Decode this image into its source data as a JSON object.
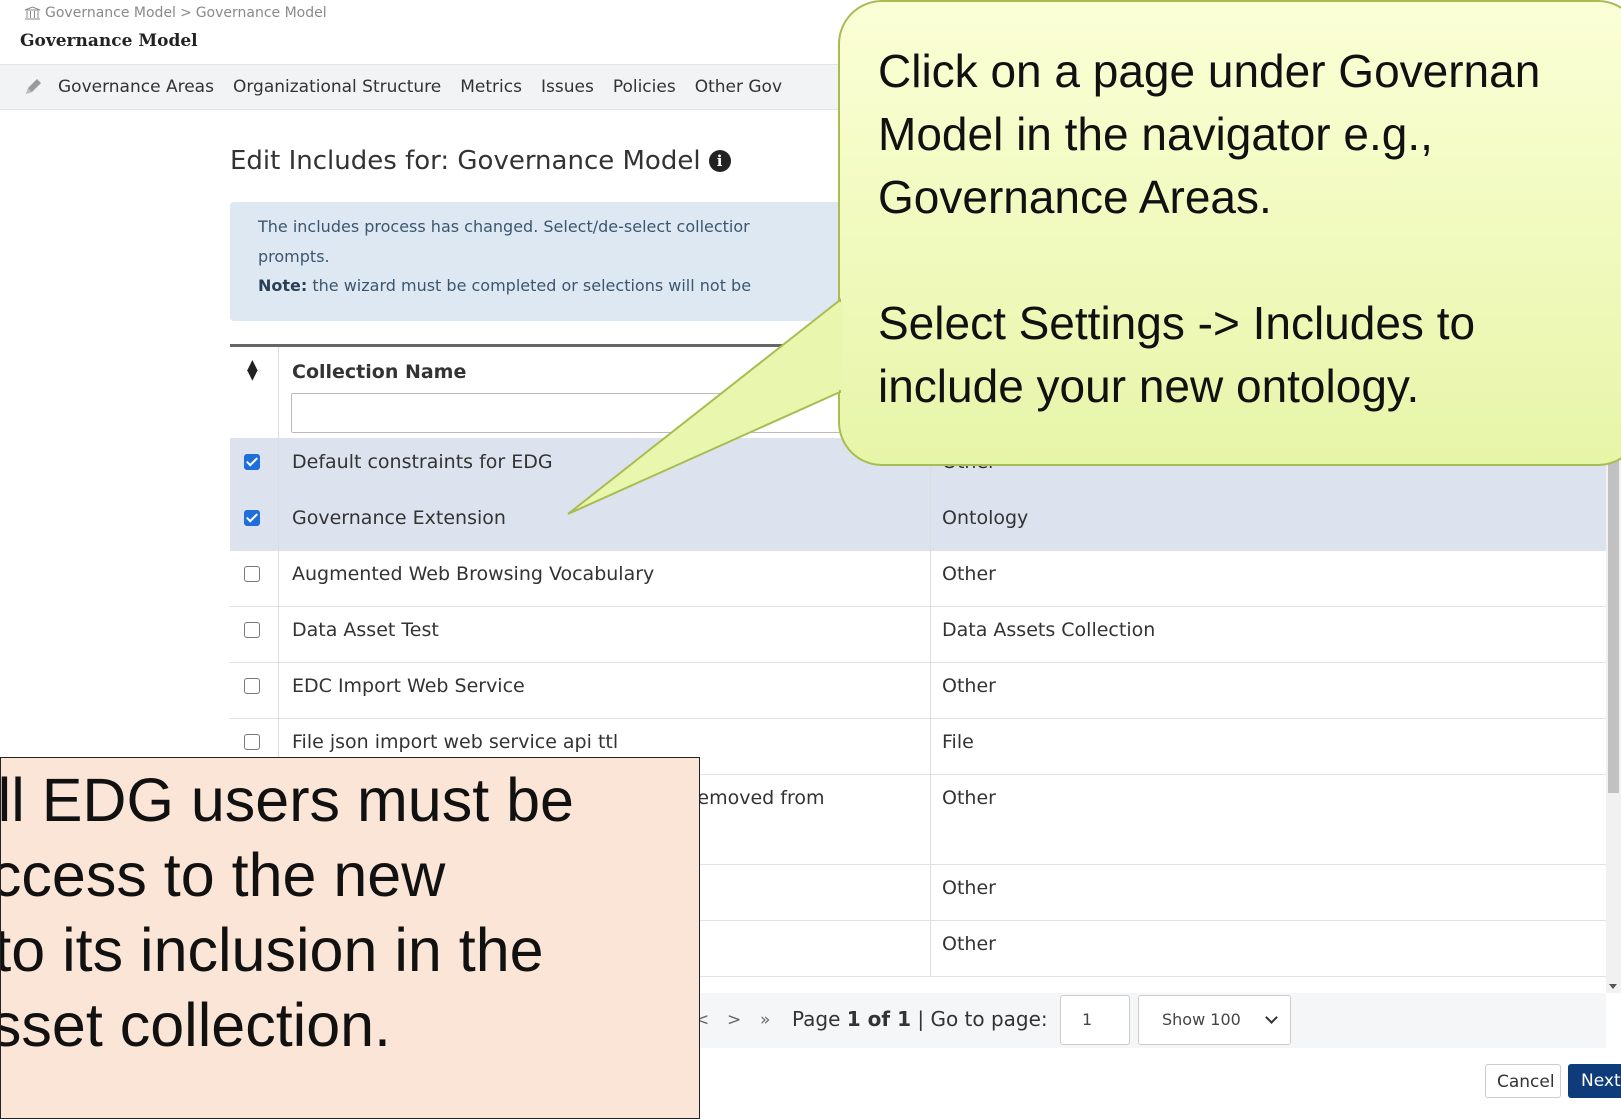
{
  "breadcrumb": {
    "root": "Governance Model",
    "separator": ">",
    "current": "Governance Model"
  },
  "page_title": "Governance Model",
  "nav": {
    "items": [
      "Governance Areas",
      "Organizational Structure",
      "Metrics",
      "Issues",
      "Policies",
      "Other Gov"
    ]
  },
  "edit": {
    "title": "Edit Includes for: Governance Model"
  },
  "infobox": {
    "line1": "The includes process has changed. Select/de-select collectior",
    "line2": "prompts.",
    "note_label": "Note:",
    "note_text": " the wizard must be completed or selections will not be"
  },
  "table": {
    "sort_icon": "sort-icon",
    "column_name": "Collection Name",
    "filter_placeholder": "",
    "rows": [
      {
        "name": "Default constraints for EDG",
        "type": "Other",
        "checked": true
      },
      {
        "name": "Governance Extension",
        "type": "Ontology",
        "checked": true
      },
      {
        "name": "Augmented Web Browsing Vocabulary",
        "type": "Other",
        "checked": false
      },
      {
        "name": "Data Asset Test",
        "type": "Data Assets Collection",
        "checked": false
      },
      {
        "name": "EDC Import Web Service",
        "type": "Other",
        "checked": false
      },
      {
        "name": "File json  import  web  service api ttl",
        "type": "File",
        "checked": false
      },
      {
        "name": "removed from",
        "type": "Other",
        "checked": false
      },
      {
        "name": "",
        "type": "Other",
        "checked": false
      },
      {
        "name": "",
        "type": "Other",
        "checked": false
      }
    ]
  },
  "pager": {
    "prev": "<",
    "next": ">",
    "last": "»",
    "page_label": "Page",
    "page_current": "1 of 1",
    "goto_label": "| Go to page:",
    "goto_value": "1",
    "show_value": "Show 100"
  },
  "buttons": {
    "cancel": "Cancel",
    "next": "Next"
  },
  "callout_green": {
    "lines": [
      "Click on a page under Governan",
      "Model in the navigator e.g.,",
      "Governance Areas.",
      "",
      "Select Settings -> Includes to",
      "include your new ontology."
    ]
  },
  "callout_peach": {
    "lines": [
      "All EDG users must be",
      "access to the new",
      "r to its inclusion in the",
      "asset collection."
    ]
  },
  "colors": {
    "accent": "#0e3c7a",
    "selected_row": "#dde3ee",
    "info_bg": "#dde8f3",
    "callout_green": "#eef8bd",
    "callout_peach": "#fbe5d6"
  }
}
